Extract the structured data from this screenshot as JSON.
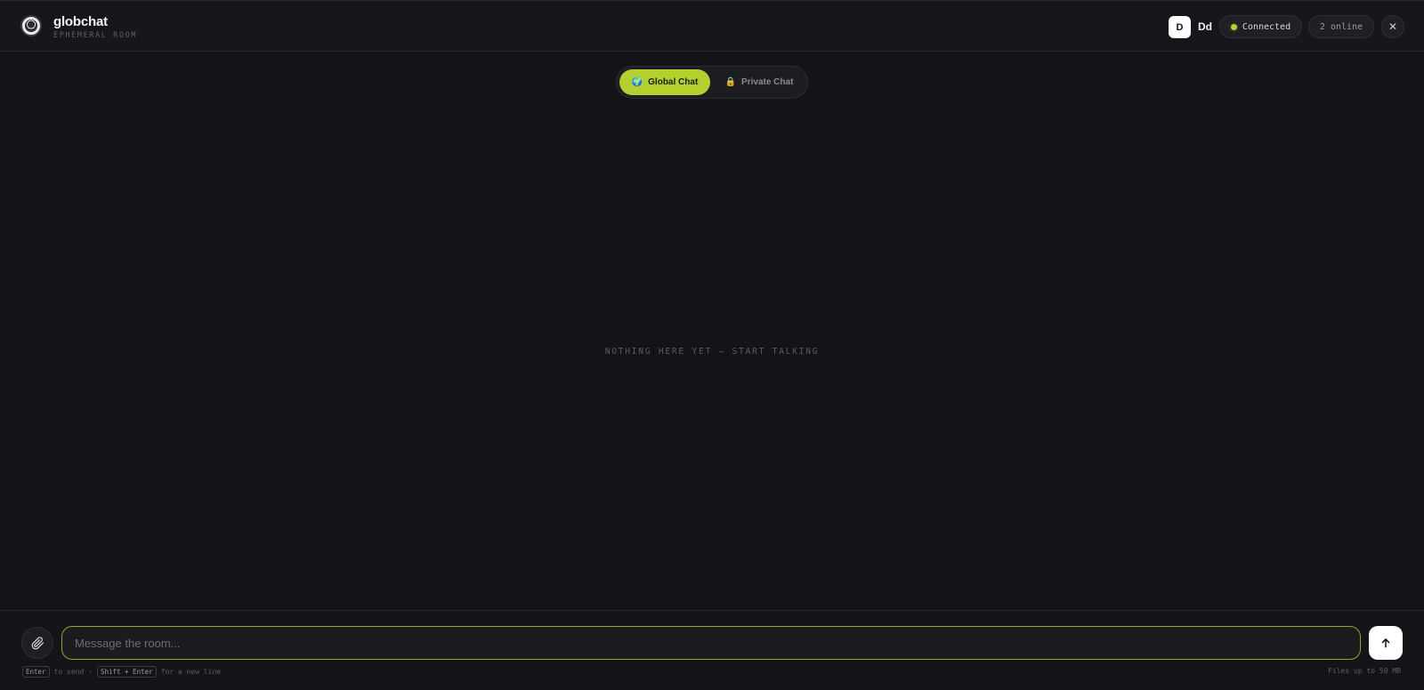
{
  "header": {
    "brand_title": "globchat",
    "brand_subtitle": "EPHEMERAL ROOM",
    "avatar_initial": "D",
    "username": "Dd",
    "status_label": "Connected",
    "online_label": "2 online",
    "close_glyph": "✕",
    "status_color": "#b5d334"
  },
  "tabs": [
    {
      "icon": "🌍",
      "label": "Global Chat",
      "active": true
    },
    {
      "icon": "🔒",
      "label": "Private Chat",
      "active": false
    }
  ],
  "main": {
    "empty_text": "NOTHING HERE YET — START TALKING"
  },
  "composer": {
    "placeholder": "Message the room...",
    "value": "",
    "hint_key_send": "Enter",
    "hint_send_text": "to send ·",
    "hint_key_newline": "Shift + Enter",
    "hint_newline_text": "for a new line",
    "files_note": "Files up to 50 MB"
  },
  "colors": {
    "accent": "#b3d02f",
    "background": "#131417"
  }
}
